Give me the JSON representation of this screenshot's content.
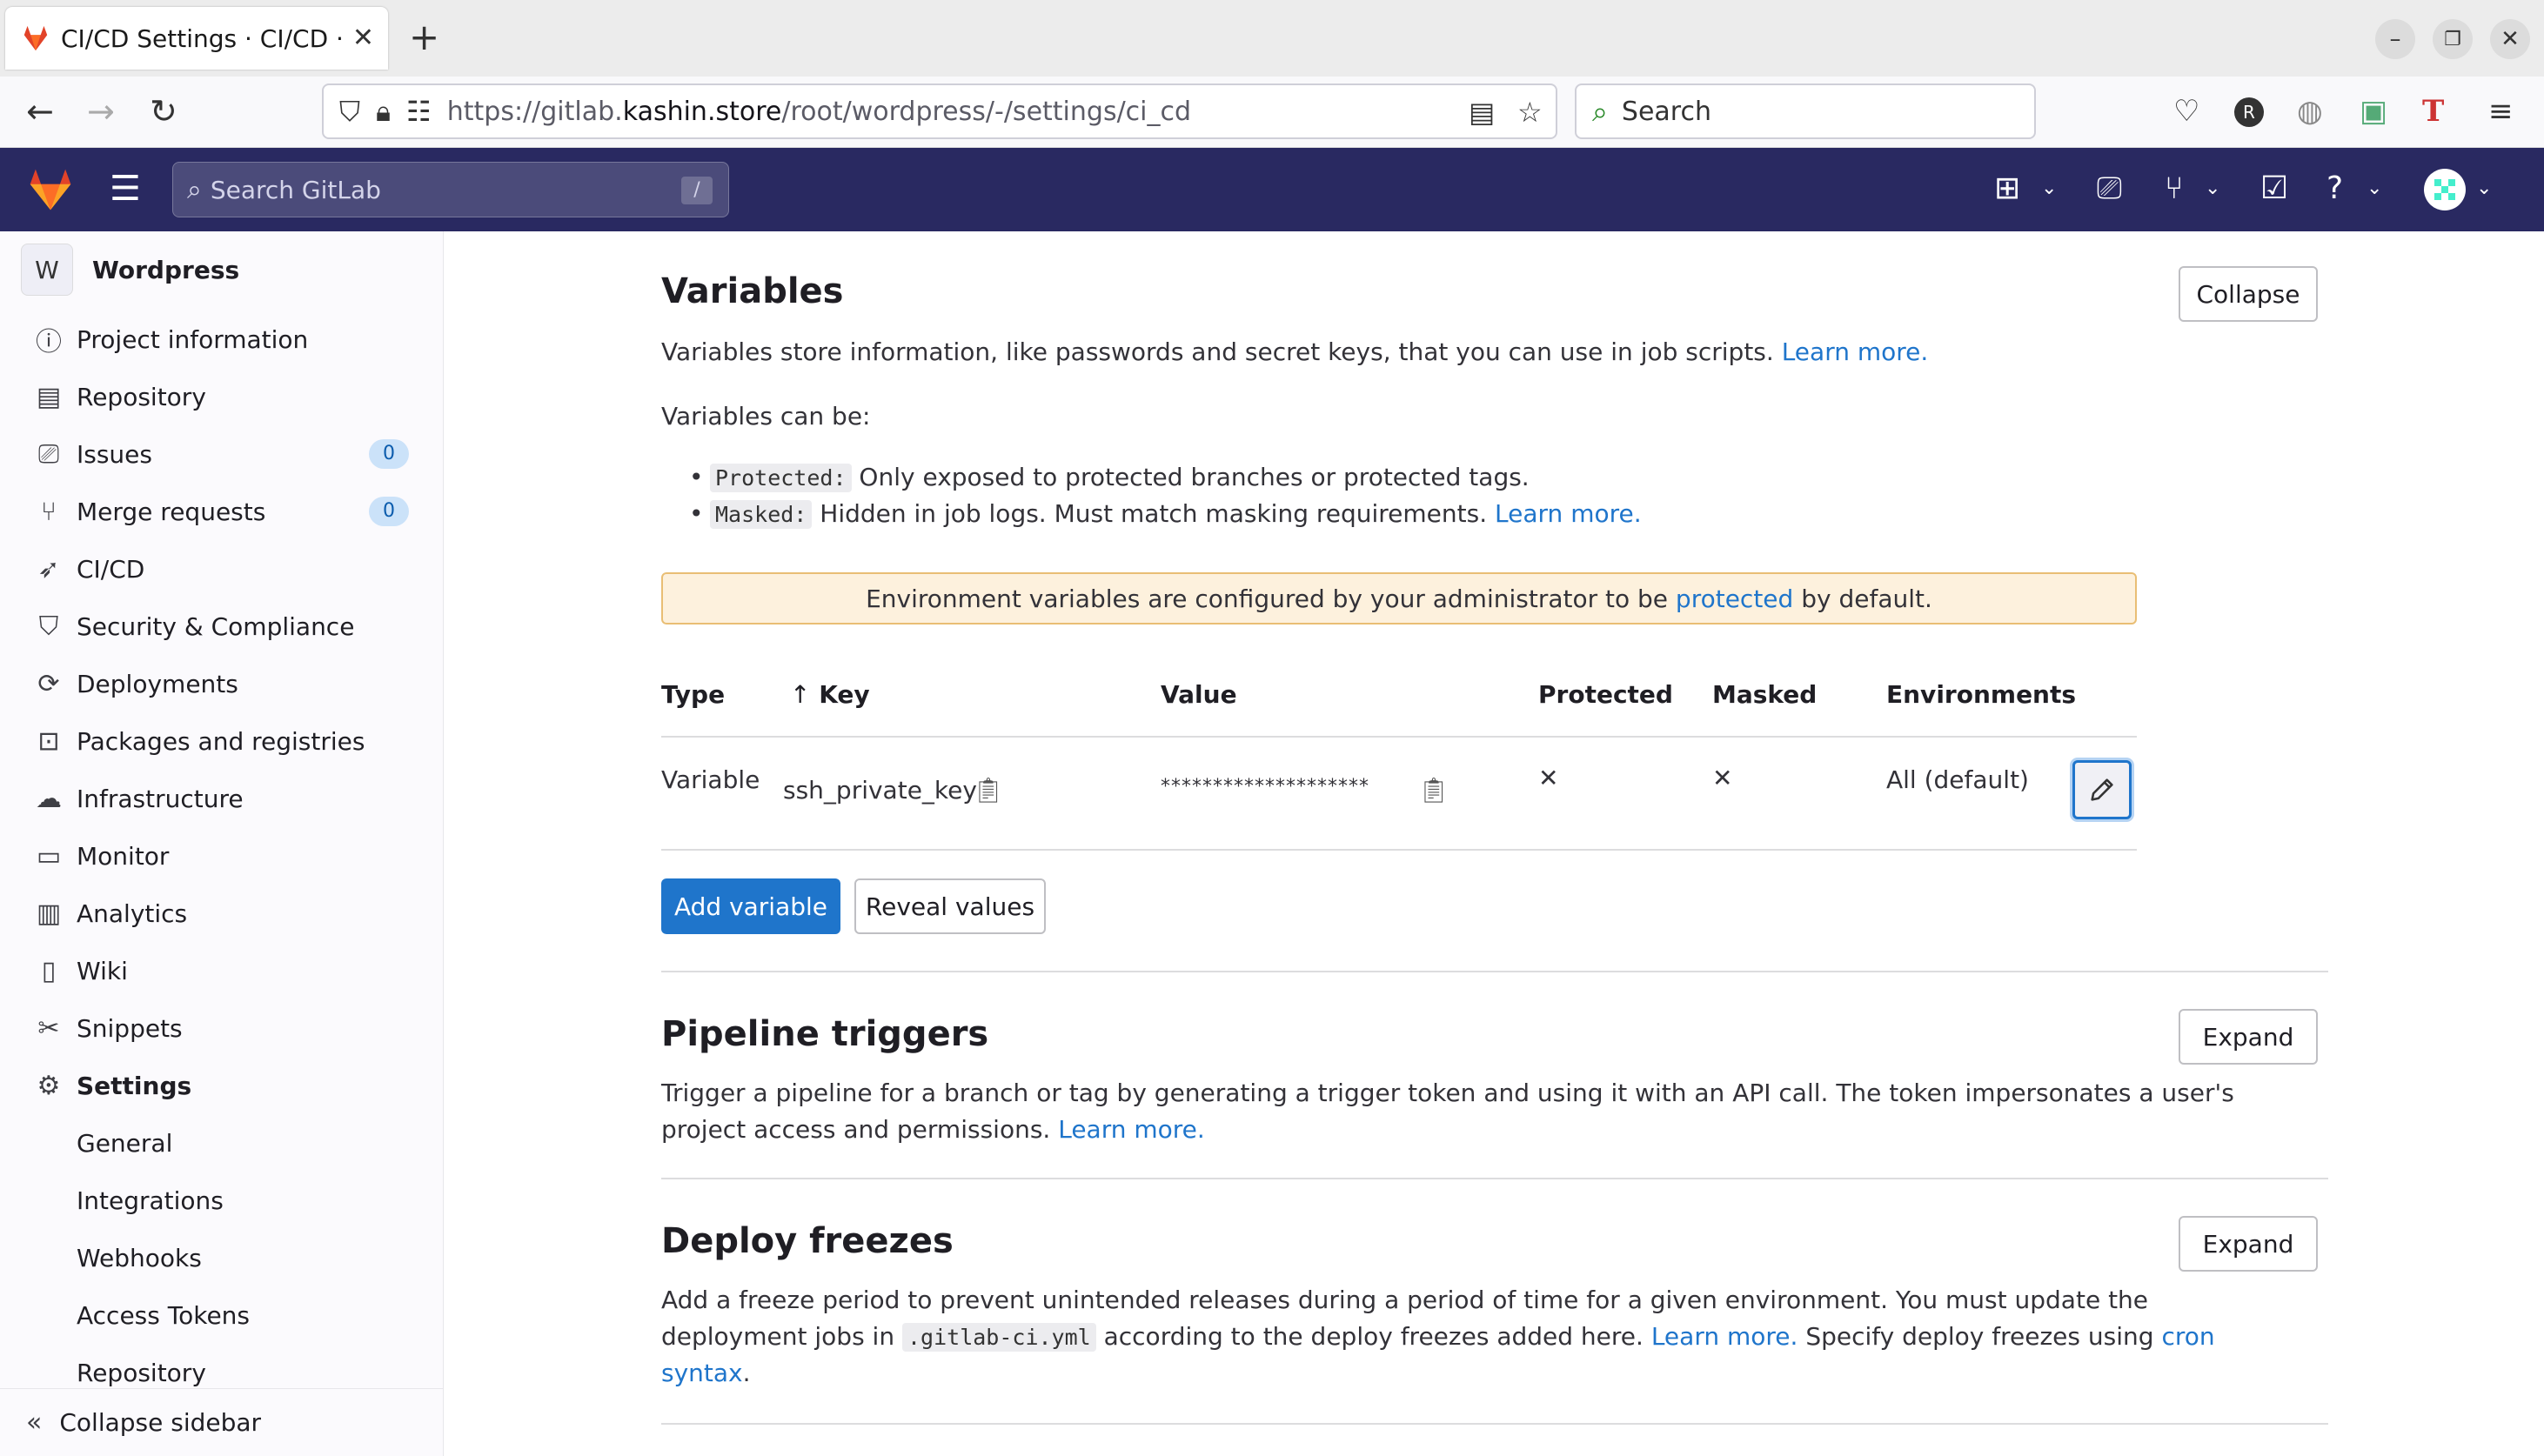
{
  "browser": {
    "tab_title": "CI/CD Settings · CI/CD · Se",
    "url_prefix": "https://gitlab.",
    "url_domain": "kashin.store",
    "url_path": "/root/wordpress/-/settings/ci_cd",
    "search_label": "Search"
  },
  "gitlab_header": {
    "search_placeholder": "Search GitLab",
    "search_shortcut": "/"
  },
  "sidebar": {
    "project_initial": "W",
    "project_name": "Wordpress",
    "items": [
      {
        "label": "Project information",
        "icon": "info-icon"
      },
      {
        "label": "Repository",
        "icon": "doc-icon"
      },
      {
        "label": "Issues",
        "icon": "issues-icon",
        "badge": "0"
      },
      {
        "label": "Merge requests",
        "icon": "merge-request-icon",
        "badge": "0"
      },
      {
        "label": "CI/CD",
        "icon": "rocket-icon"
      },
      {
        "label": "Security & Compliance",
        "icon": "shield-icon"
      },
      {
        "label": "Deployments",
        "icon": "deployments-icon"
      },
      {
        "label": "Packages and registries",
        "icon": "package-icon"
      },
      {
        "label": "Infrastructure",
        "icon": "cloud-icon"
      },
      {
        "label": "Monitor",
        "icon": "monitor-icon"
      },
      {
        "label": "Analytics",
        "icon": "chart-icon"
      },
      {
        "label": "Wiki",
        "icon": "book-icon"
      },
      {
        "label": "Snippets",
        "icon": "scissors-icon"
      },
      {
        "label": "Settings",
        "icon": "gear-icon"
      }
    ],
    "sub_items": [
      "General",
      "Integrations",
      "Webhooks",
      "Access Tokens",
      "Repository"
    ],
    "collapse_label": "Collapse sidebar"
  },
  "variables": {
    "title": "Variables",
    "collapse_label": "Collapse",
    "description": "Variables store information, like passwords and secret keys, that you can use in job scripts.",
    "learn_more": "Learn more.",
    "can_be": "Variables can be:",
    "bullet1_code": "Protected:",
    "bullet1_text": "Only exposed to protected branches or protected tags.",
    "bullet2_code": "Masked:",
    "bullet2_text": "Hidden in job logs. Must match masking requirements.",
    "bullet2_link": "Learn more.",
    "alert_pre": "Environment variables are configured by your administrator to be",
    "alert_link": "protected",
    "alert_post": "by default.",
    "table": {
      "headers": [
        "Type",
        "Key",
        "Value",
        "Protected",
        "Masked",
        "Environments"
      ],
      "sort_arrow": "↑",
      "rows": [
        {
          "type": "Variable",
          "key": "ssh_private_key",
          "value": "********************",
          "protected": "✕",
          "masked": "✕",
          "environments": "All (default)"
        }
      ]
    },
    "add_label": "Add variable",
    "reveal_label": "Reveal values"
  },
  "pipeline_triggers": {
    "title": "Pipeline triggers",
    "expand_label": "Expand",
    "line1": "Trigger a pipeline for a branch or tag by generating a trigger token and using it with an API call. The token impersonates a user's",
    "line2": "project access and permissions.",
    "learn_more": "Learn more."
  },
  "deploy_freezes": {
    "title": "Deploy freezes",
    "expand_label": "Expand",
    "line1": "Add a freeze period to prevent unintended releases during a period of time for a given environment. You must update the",
    "line2_pre": "deployment jobs in",
    "line2_code": ".gitlab-ci.yml",
    "line2_mid": "according to the deploy freezes added here.",
    "learn_more": "Learn more.",
    "line2_post": "Specify deploy freezes using",
    "cron_link_1": "cron",
    "cron_link_2": "syntax",
    "period": "."
  },
  "colors": {
    "gitlab_header": "#292961",
    "link": "#1f75cb",
    "alert_bg": "#fdf1dd",
    "primary_button": "#1f75cb"
  }
}
